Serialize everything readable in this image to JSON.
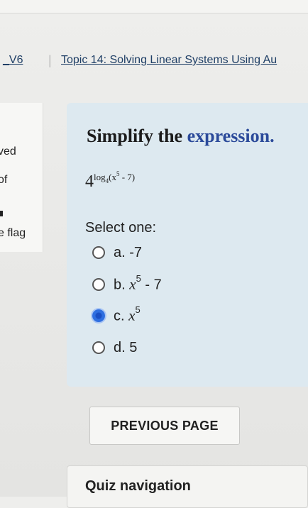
{
  "breadcrumb": {
    "course": "_V6",
    "separator": "|",
    "topic": "Topic 14: Solving Linear Systems Using Au"
  },
  "info_panel": {
    "line1": "ved",
    "line2": "of",
    "line3": "e flag"
  },
  "question": {
    "title_plain": "Simplify the",
    "title_accent": "expression.",
    "expression": {
      "base": "4",
      "log": "log",
      "log_base": "4",
      "arg_open": "(x",
      "arg_power": "5",
      "arg_rest": " - 7)"
    },
    "select_label": "Select one:",
    "options": [
      {
        "prefix": "a. -7",
        "math": "",
        "power": "",
        "suffix": "",
        "checked": false
      },
      {
        "prefix": "b. ",
        "math": "x",
        "power": "5",
        "suffix": " - 7",
        "checked": false
      },
      {
        "prefix": "c. ",
        "math": "x",
        "power": "5",
        "suffix": "",
        "checked": true
      },
      {
        "prefix": "d. 5",
        "math": "",
        "power": "",
        "suffix": "",
        "checked": false
      }
    ]
  },
  "buttons": {
    "previous_page": "PREVIOUS PAGE"
  },
  "quiz_nav": {
    "title": "Quiz navigation"
  },
  "colors": {
    "question_bg": "#dde9f0",
    "accent_text": "#2b4a9a",
    "link": "#1f3f66",
    "radio_checked": "#2f6fe0"
  },
  "icons": {
    "radio_selected": "radio-selected-icon",
    "radio_unselected": "radio-unselected-icon"
  }
}
